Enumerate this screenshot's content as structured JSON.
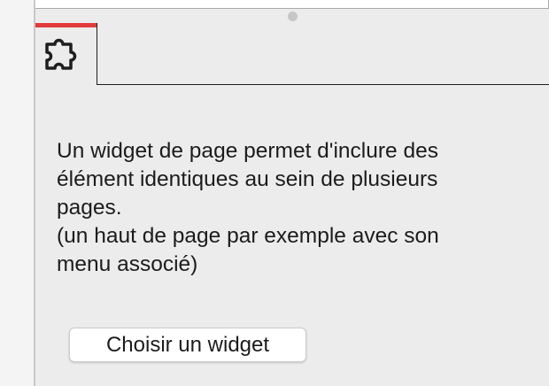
{
  "tab": {
    "icon": "puzzle-piece-icon",
    "accent_color": "#e23b3b"
  },
  "widget_panel": {
    "description": "Un widget de page permet d'inclure des\nélément identiques au sein de plusieurs\npages.\n(un haut de page par exemple avec son\nmenu associé)",
    "choose_button_label": "Choisir un widget"
  }
}
